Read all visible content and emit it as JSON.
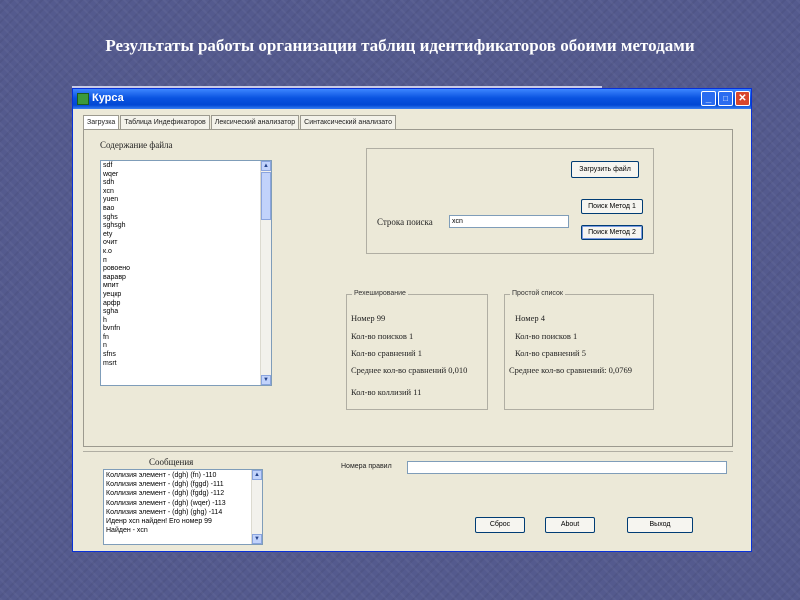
{
  "slide": {
    "title": "Результаты работы организации таблиц идентификаторов обоими методами"
  },
  "window": {
    "title": "Курса",
    "controls": {
      "minimize": "_",
      "maximize": "□",
      "close": "✕"
    }
  },
  "tabs": [
    {
      "label": "Загрузка",
      "active": true
    },
    {
      "label": "Таблица Индефикаторов",
      "active": false
    },
    {
      "label": "Лексический анализатор",
      "active": false
    },
    {
      "label": "Синтаксический анализато",
      "active": false
    }
  ],
  "file_panel": {
    "label": "Содержание файла",
    "items": [
      "sdf",
      "wqer",
      "sdh",
      "xcn",
      "yuen",
      "вао",
      "sghs",
      "sghsgh",
      "ety",
      "очит",
      "к.о",
      "п",
      "ровоено",
      "варавр",
      "мпит",
      "уецкр",
      "арфр",
      "sgha",
      "h",
      "bvnfn",
      "fn",
      "n",
      "sfns",
      "msrt"
    ]
  },
  "search": {
    "load_button": "Загрузить файл",
    "search_label": "Строка поиска",
    "search_value": "xcn",
    "method1_button": "Поиск Метод 1",
    "method2_button": "Поиск Метод 2"
  },
  "rehash": {
    "caption": "Рехеширование",
    "number": "Номер 99",
    "searches": "Кол-во поисков 1",
    "comparisons": "Кол-во сравнений 1",
    "avg_comparisons": "Среднее кол-во сравнений 0,010",
    "collisions": "Кол-во коллизий 11"
  },
  "simple_list": {
    "caption": "Простой список",
    "number": "Номер 4",
    "searches": "Кол-во поисков 1",
    "comparisons": "Кол-во сравнений 5",
    "avg_comparisons": "Среднее кол-во сравнений: 0,0769"
  },
  "messages": {
    "label": "Сообщения",
    "items": [
      "Коллизия элемент - (dgh) (fn) -110",
      "Коллизия элемент - (dgh) (fggd) -111",
      "Коллизия элемент - (dgh) (fgdg) -112",
      "Коллизия элемент - (dgh) (wqer) -113",
      "Коллизия элемент - (dgh) (ghg) -114",
      "Иденр  xcn найден! Его номер 99",
      "Найден - xcn"
    ]
  },
  "rules": {
    "label": "Номера  правил",
    "value": ""
  },
  "bottom_buttons": {
    "reset": "Сброс",
    "about": "About",
    "exit": "Выход"
  },
  "colors": {
    "background": "#545a8e",
    "titlebar": "#0a53e0",
    "window": "#ece9d8"
  }
}
